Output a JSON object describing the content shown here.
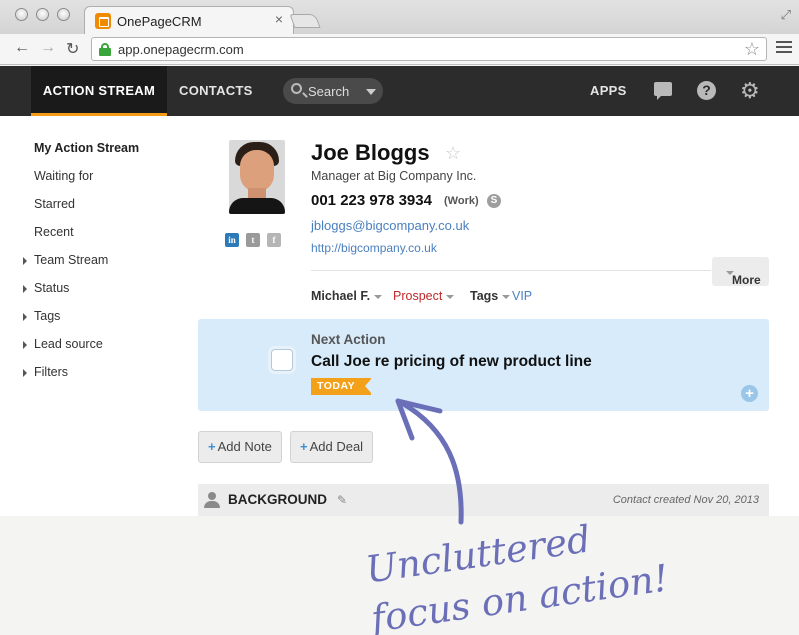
{
  "browser": {
    "tab_title": "OnePageCRM",
    "tab_close": "×",
    "url": "app.onepagecrm.com"
  },
  "nav": {
    "action_stream": "ACTION STREAM",
    "contacts": "CONTACTS",
    "search_label": "Search",
    "apps": "APPS",
    "help": "?"
  },
  "sidebar": {
    "items": [
      {
        "label": "My Action Stream"
      },
      {
        "label": "Waiting for"
      },
      {
        "label": "Starred"
      },
      {
        "label": "Recent"
      },
      {
        "label": "Team Stream"
      },
      {
        "label": "Status"
      },
      {
        "label": "Tags"
      },
      {
        "label": "Lead source"
      },
      {
        "label": "Filters"
      }
    ]
  },
  "contact": {
    "name": "Joe Bloggs",
    "job": "Manager at Big Company Inc.",
    "phone": "001 223 978 3934",
    "phone_type": "(Work)",
    "email": "jbloggs@bigcompany.co.uk",
    "website": "http://bigcompany.co.uk",
    "owner": "Michael F.",
    "status": "Prospect",
    "tags_label": "Tags",
    "tag": "VIP",
    "more": "More",
    "social": [
      "in",
      "t",
      "f"
    ]
  },
  "next_action": {
    "label": "Next Action",
    "text": "Call Joe re pricing of new product line",
    "badge": "TODAY",
    "add": "+"
  },
  "buttons": {
    "add_note": "Add Note",
    "add_deal": "Add Deal",
    "plus": "+"
  },
  "background": {
    "title": "BACKGROUND",
    "created": "Contact created Nov 20, 2013"
  },
  "annotation": {
    "line1": "Uncluttered",
    "line2": "focus on action!"
  },
  "colors": {
    "accent": "#f49a14",
    "link": "#4a7fbf",
    "status": "#c0292c",
    "highlight": "#d7ebfa",
    "annotation": "#6a6fb8"
  }
}
